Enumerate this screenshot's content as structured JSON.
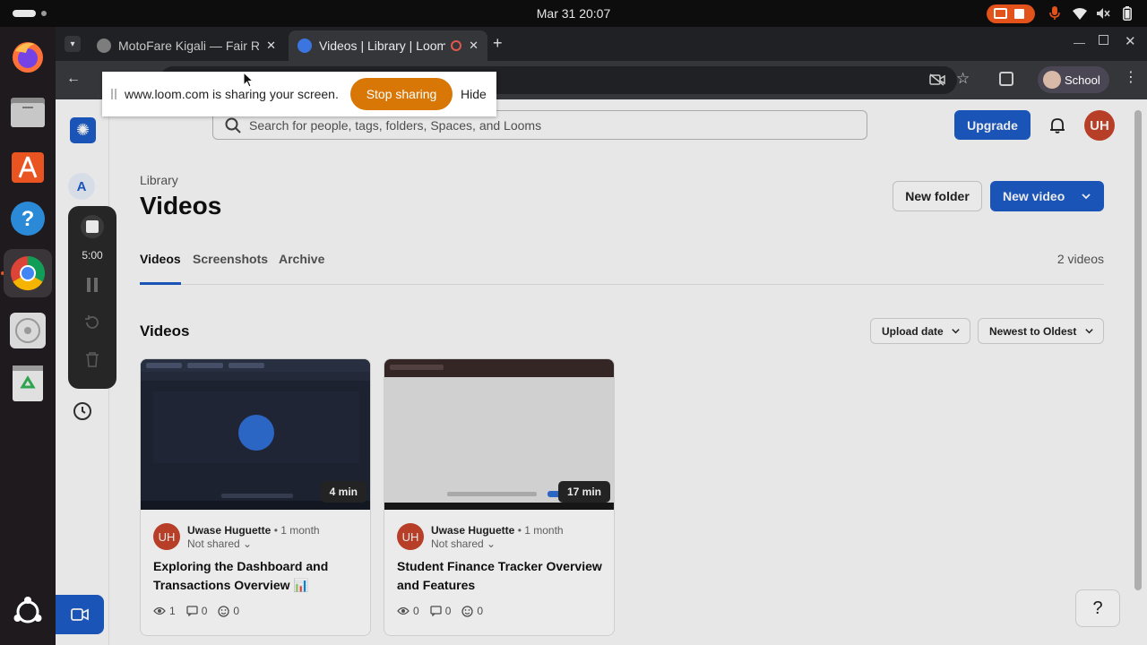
{
  "system": {
    "clock": "Mar 31  20:07"
  },
  "browser": {
    "tabs": [
      {
        "title": "MotoFare Kigali — Fair R",
        "active": false
      },
      {
        "title": "Videos | Library | Loom",
        "active": true
      }
    ],
    "profile_label": "School"
  },
  "share_bar": {
    "message": "www.loom.com is sharing your screen.",
    "stop_label": "Stop sharing",
    "hide_label": "Hide"
  },
  "recorder": {
    "time": "5:00"
  },
  "header": {
    "search_placeholder": "Search for people, tags, folders, Spaces, and Looms",
    "upgrade_label": "Upgrade",
    "avatar_initials": "UH"
  },
  "sidebar": {
    "workspace_initial": "A"
  },
  "library": {
    "breadcrumb": "Library",
    "title": "Videos",
    "new_folder_label": "New folder",
    "new_video_label": "New video",
    "tabs": [
      {
        "label": "Videos",
        "active": true
      },
      {
        "label": "Screenshots",
        "active": false
      },
      {
        "label": "Archive",
        "active": false
      }
    ],
    "count": "2 videos",
    "section_title": "Videos",
    "sort_by": "Upload date",
    "sort_order": "Newest to Oldest"
  },
  "videos": [
    {
      "duration": "4 min",
      "author_initials": "UH",
      "author": "Uwase Huguette",
      "age": "1 month",
      "share_status": "Not shared",
      "title": "Exploring the Dashboard and Transactions Overview 📊",
      "views": "1",
      "comments": "0",
      "reactions": "0"
    },
    {
      "duration": "17 min",
      "author_initials": "UH",
      "author": "Uwase Huguette",
      "age": "1 month",
      "share_status": "Not shared",
      "title": "Student Finance Tracker Overview and Features",
      "views": "0",
      "comments": "0",
      "reactions": "0"
    }
  ],
  "colors": {
    "accent": "#1d5cc7",
    "share_button": "#d97706",
    "avatar": "#c8452b",
    "ubuntu_orange": "#e95420"
  },
  "icons": [
    "search-icon",
    "bell-icon",
    "clock-icon",
    "camera-icon",
    "eye-icon",
    "comment-icon",
    "emoji-icon",
    "help-icon"
  ]
}
